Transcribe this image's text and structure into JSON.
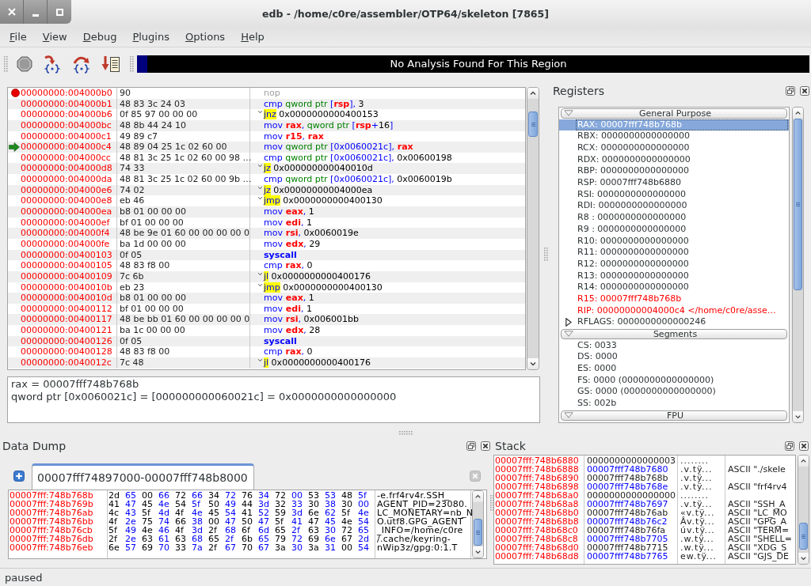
{
  "window": {
    "title": "edb - /home/c0re/assembler/OTP64/skeleton [7865]"
  },
  "menu": [
    "File",
    "View",
    "Debug",
    "Plugins",
    "Options",
    "Help"
  ],
  "toolbar": {
    "analysis": "No Analysis Found For This Region"
  },
  "disassembly": {
    "rows": [
      {
        "address": "00000000:004000b0",
        "bytes": "90",
        "breakpoint": true,
        "current": false,
        "kind": "nop",
        "mnemonic": "nop"
      },
      {
        "address": "00000000:004000b1",
        "bytes": "48 83 3c 24 03",
        "breakpoint": false,
        "current": false,
        "kind": "normal",
        "mnemonic": "cmp",
        "operands": [
          {
            "kind": "size",
            "text": " qword ptr"
          },
          {
            "kind": "punct",
            "text": " ["
          },
          {
            "kind": "register",
            "text": "rsp"
          },
          {
            "kind": "punct",
            "text": "],"
          },
          {
            "kind": "number",
            "text": " 3"
          }
        ]
      },
      {
        "address": "00000000:004000b6",
        "bytes": "0f 85 97 00 00 00",
        "breakpoint": false,
        "current": false,
        "kind": "jump",
        "mnemonic": "jnz",
        "operands": [
          {
            "kind": "number",
            "text": " 0x0000000000400153"
          }
        ]
      },
      {
        "address": "00000000:004000bc",
        "bytes": "48 8b 44 24 10",
        "breakpoint": false,
        "current": false,
        "kind": "normal",
        "mnemonic": "mov",
        "operands": [
          {
            "kind": "register",
            "text": " rax"
          },
          {
            "kind": "punct",
            "text": ","
          },
          {
            "kind": "size",
            "text": " qword ptr"
          },
          {
            "kind": "punct",
            "text": " ["
          },
          {
            "kind": "register",
            "text": "rsp"
          },
          {
            "kind": "punct",
            "text": "+"
          },
          {
            "kind": "number",
            "text": "16"
          },
          {
            "kind": "punct",
            "text": "]"
          }
        ]
      },
      {
        "address": "00000000:004000c1",
        "bytes": "49 89 c7",
        "breakpoint": false,
        "current": false,
        "kind": "normal",
        "mnemonic": "mov",
        "operands": [
          {
            "kind": "register",
            "text": " r15"
          },
          {
            "kind": "punct",
            "text": ","
          },
          {
            "kind": "register",
            "text": " rax"
          }
        ]
      },
      {
        "address": "00000000:004000c4",
        "bytes": "48 89 04 25 1c 02 60 00",
        "breakpoint": false,
        "current": true,
        "kind": "normal",
        "mnemonic": "mov",
        "operands": [
          {
            "kind": "size",
            "text": " qword ptr"
          },
          {
            "kind": "punct",
            "text": " [0x0060021c],"
          },
          {
            "kind": "register",
            "text": " rax"
          }
        ]
      },
      {
        "address": "00000000:004000cc",
        "bytes": "48 81 3c 25 1c 02 60 00 98 …",
        "breakpoint": false,
        "current": false,
        "kind": "normal",
        "mnemonic": "cmp",
        "operands": [
          {
            "kind": "size",
            "text": " qword ptr"
          },
          {
            "kind": "punct",
            "text": " [0x0060021c],"
          },
          {
            "kind": "number",
            "text": " 0x00600198"
          }
        ]
      },
      {
        "address": "00000000:004000d8",
        "bytes": "74 33",
        "breakpoint": false,
        "current": false,
        "kind": "jump",
        "mnemonic": "jz",
        "operands": [
          {
            "kind": "number",
            "text": " 0x000000000040010d"
          }
        ]
      },
      {
        "address": "00000000:004000da",
        "bytes": "48 81 3c 25 1c 02 60 00 9b …",
        "breakpoint": false,
        "current": false,
        "kind": "normal",
        "mnemonic": "cmp",
        "operands": [
          {
            "kind": "size",
            "text": " qword ptr"
          },
          {
            "kind": "punct",
            "text": " [0x0060021c],"
          },
          {
            "kind": "number",
            "text": " 0x0060019b"
          }
        ]
      },
      {
        "address": "00000000:004000e6",
        "bytes": "74 02",
        "breakpoint": false,
        "current": false,
        "kind": "jump",
        "mnemonic": "jz",
        "operands": [
          {
            "kind": "number",
            "text": " 0x00000000004000ea"
          }
        ]
      },
      {
        "address": "00000000:004000e8",
        "bytes": "eb 46",
        "breakpoint": false,
        "current": false,
        "kind": "jump",
        "mnemonic": "jmp",
        "operands": [
          {
            "kind": "number",
            "text": " 0x0000000000400130"
          }
        ]
      },
      {
        "address": "00000000:004000ea",
        "bytes": "b8 01 00 00 00",
        "breakpoint": false,
        "current": false,
        "kind": "normal",
        "mnemonic": "mov",
        "operands": [
          {
            "kind": "register",
            "text": " eax"
          },
          {
            "kind": "punct",
            "text": ","
          },
          {
            "kind": "number",
            "text": " 1"
          }
        ]
      },
      {
        "address": "00000000:004000ef",
        "bytes": "bf 01 00 00 00",
        "breakpoint": false,
        "current": false,
        "kind": "normal",
        "mnemonic": "mov",
        "operands": [
          {
            "kind": "register",
            "text": " edi"
          },
          {
            "kind": "punct",
            "text": ","
          },
          {
            "kind": "number",
            "text": " 1"
          }
        ]
      },
      {
        "address": "00000000:004000f4",
        "bytes": "48 be 9e 01 60 00 00 00 00 0",
        "breakpoint": false,
        "current": false,
        "kind": "normal",
        "mnemonic": "mov",
        "operands": [
          {
            "kind": "register",
            "text": " rsi"
          },
          {
            "kind": "punct",
            "text": ","
          },
          {
            "kind": "number",
            "text": " 0x0060019e"
          }
        ]
      },
      {
        "address": "00000000:004000fe",
        "bytes": "ba 1d 00 00 00",
        "breakpoint": false,
        "current": false,
        "kind": "normal",
        "mnemonic": "mov",
        "operands": [
          {
            "kind": "register",
            "text": " edx"
          },
          {
            "kind": "punct",
            "text": ","
          },
          {
            "kind": "number",
            "text": " 29"
          }
        ]
      },
      {
        "address": "00000000:00400103",
        "bytes": "0f 05",
        "breakpoint": false,
        "current": false,
        "kind": "syscall",
        "mnemonic": "syscall"
      },
      {
        "address": "00000000:00400105",
        "bytes": "48 83 f8 00",
        "breakpoint": false,
        "current": false,
        "kind": "normal",
        "mnemonic": "cmp",
        "operands": [
          {
            "kind": "register",
            "text": " rax"
          },
          {
            "kind": "punct",
            "text": ","
          },
          {
            "kind": "number",
            "text": " 0"
          }
        ]
      },
      {
        "address": "00000000:00400109",
        "bytes": "7c 6b",
        "breakpoint": false,
        "current": false,
        "kind": "jump",
        "mnemonic": "jl",
        "operands": [
          {
            "kind": "number",
            "text": " 0x0000000000400176"
          }
        ]
      },
      {
        "address": "00000000:0040010b",
        "bytes": "eb 23",
        "breakpoint": false,
        "current": false,
        "kind": "jump",
        "mnemonic": "jmp",
        "operands": [
          {
            "kind": "number",
            "text": " 0x0000000000400130"
          }
        ]
      },
      {
        "address": "00000000:0040010d",
        "bytes": "b8 01 00 00 00",
        "breakpoint": false,
        "current": false,
        "kind": "normal",
        "mnemonic": "mov",
        "operands": [
          {
            "kind": "register",
            "text": " eax"
          },
          {
            "kind": "punct",
            "text": ","
          },
          {
            "kind": "number",
            "text": " 1"
          }
        ]
      },
      {
        "address": "00000000:00400112",
        "bytes": "bf 01 00 00 00",
        "breakpoint": false,
        "current": false,
        "kind": "normal",
        "mnemonic": "mov",
        "operands": [
          {
            "kind": "register",
            "text": " edi"
          },
          {
            "kind": "punct",
            "text": ","
          },
          {
            "kind": "number",
            "text": " 1"
          }
        ]
      },
      {
        "address": "00000000:00400117",
        "bytes": "48 be bb 01 60 00 00 00 00 0",
        "breakpoint": false,
        "current": false,
        "kind": "normal",
        "mnemonic": "mov",
        "operands": [
          {
            "kind": "register",
            "text": " rsi"
          },
          {
            "kind": "punct",
            "text": ","
          },
          {
            "kind": "number",
            "text": " 0x006001bb"
          }
        ]
      },
      {
        "address": "00000000:00400121",
        "bytes": "ba 1c 00 00 00",
        "breakpoint": false,
        "current": false,
        "kind": "normal",
        "mnemonic": "mov",
        "operands": [
          {
            "kind": "register",
            "text": " edx"
          },
          {
            "kind": "punct",
            "text": ","
          },
          {
            "kind": "number",
            "text": " 28"
          }
        ]
      },
      {
        "address": "00000000:00400126",
        "bytes": "0f 05",
        "breakpoint": false,
        "current": false,
        "kind": "syscall",
        "mnemonic": "syscall"
      },
      {
        "address": "00000000:00400128",
        "bytes": "48 83 f8 00",
        "breakpoint": false,
        "current": false,
        "kind": "normal",
        "mnemonic": "cmp",
        "operands": [
          {
            "kind": "register",
            "text": " rax"
          },
          {
            "kind": "punct",
            "text": ","
          },
          {
            "kind": "number",
            "text": " 0"
          }
        ]
      },
      {
        "address": "00000000:0040012c",
        "bytes": "7c 48",
        "breakpoint": false,
        "current": false,
        "kind": "jump",
        "mnemonic": "jl",
        "operands": [
          {
            "kind": "number",
            "text": " 0x0000000000400176"
          }
        ]
      }
    ]
  },
  "expression": [
    "rax = 00007fff748b768b",
    "qword ptr [0x0060021c] = [000000000060021c] = 0x0000000000000000"
  ],
  "registers": {
    "title": "Registers",
    "groups": [
      {
        "title": "General Purpose",
        "expanded": true,
        "registers": [
          {
            "text": "RAX: 00007fff748b768b",
            "selected": true,
            "changed": false
          },
          {
            "text": "RBX: 0000000000000000",
            "selected": false,
            "changed": false
          },
          {
            "text": "RCX: 0000000000000000",
            "selected": false,
            "changed": false
          },
          {
            "text": "RDX: 0000000000000000",
            "selected": false,
            "changed": false
          },
          {
            "text": "RBP: 0000000000000000",
            "selected": false,
            "changed": false
          },
          {
            "text": "RSP: 00007fff748b6880",
            "selected": false,
            "changed": false
          },
          {
            "text": "RSI: 0000000000000000",
            "selected": false,
            "changed": false
          },
          {
            "text": "RDI: 0000000000000000",
            "selected": false,
            "changed": false
          },
          {
            "text": "R8 : 0000000000000000",
            "selected": false,
            "changed": false
          },
          {
            "text": "R9 : 0000000000000000",
            "selected": false,
            "changed": false
          },
          {
            "text": "R10: 0000000000000000",
            "selected": false,
            "changed": false
          },
          {
            "text": "R11: 0000000000000000",
            "selected": false,
            "changed": false
          },
          {
            "text": "R12: 0000000000000000",
            "selected": false,
            "changed": false
          },
          {
            "text": "R13: 0000000000000000",
            "selected": false,
            "changed": false
          },
          {
            "text": "R14: 0000000000000000",
            "selected": false,
            "changed": false
          },
          {
            "text": "R15: 00007fff748b768b",
            "selected": false,
            "changed": true
          },
          {
            "text": "RIP: 00000000004000c4 </home/c0re/asse…",
            "selected": false,
            "changed": true
          }
        ],
        "flags": {
          "text": "RFLAGS: 0000000000000246",
          "expanded": false
        }
      },
      {
        "title": "Segments",
        "expanded": true,
        "registers": [
          {
            "text": "CS: 0033",
            "selected": false,
            "changed": false
          },
          {
            "text": "DS: 0000",
            "selected": false,
            "changed": false
          },
          {
            "text": "ES: 0000",
            "selected": false,
            "changed": false
          },
          {
            "text": "FS: 0000 (0000000000000000)",
            "selected": false,
            "changed": false
          },
          {
            "text": "GS: 0000 (0000000000000000)",
            "selected": false,
            "changed": false
          },
          {
            "text": "SS: 002b",
            "selected": false,
            "changed": false
          }
        ]
      },
      {
        "title": "FPU",
        "expanded": true
      }
    ]
  },
  "data_dump": {
    "title": "Data Dump",
    "tabs": [
      {
        "label": "00007fff74897000-00007fff748b8000",
        "selected": true
      }
    ],
    "rows": [
      {
        "address": "00007fff:748b768b",
        "bytes": "2d 65 00 66 72 66 34 72 76 34 72 00 53 53 48 5f",
        "ascii": "-e.frf4rv4r.SSH_"
      },
      {
        "address": "00007fff:748b769b",
        "bytes": "41 47 45 4e 54 5f 50 49 44 3d 32 33 30 38 30 00",
        "ascii": "AGENT_PID=23080."
      },
      {
        "address": "00007fff:748b76ab",
        "bytes": "4c 43 5f 4d 4f 4e 45 54 41 52 59 3d 6e 62 5f 4e",
        "ascii": "LC_MONETARY=nb_N"
      },
      {
        "address": "00007fff:748b76bb",
        "bytes": "4f 2e 75 74 66 38 00 47 50 47 5f 41 47 45 4e 54",
        "ascii": "O.utf8.GPG_AGENT"
      },
      {
        "address": "00007fff:748b76cb",
        "bytes": "5f 49 4e 46 4f 3d 2f 68 6f 6d 65 2f 63 30 72 65",
        "ascii": "_INFO=/home/c0re"
      },
      {
        "address": "00007fff:748b76db",
        "bytes": "2f 2e 63 61 63 68 65 2f 6b 65 79 72 69 6e 67 2d",
        "ascii": "/.cache/keyring-"
      },
      {
        "address": "00007fff:748b76eb",
        "bytes": "6e 57 69 70 33 7a 2f 67 70 67 3a 30 3a 31 00 54",
        "ascii": "nWip3z/gpg:0:1.T"
      }
    ]
  },
  "stack": {
    "title": "Stack",
    "rows": [
      {
        "address": "00007fff:748b6880",
        "value": "0000000000000003",
        "ascii": "........"
      },
      {
        "address": "00007fff:748b6888",
        "value": "00007fff748b7680",
        "ascii": ".v.tÿ...",
        "comment": "ASCII \"./skele"
      },
      {
        "address": "00007fff:748b6890",
        "value": "00007fff748b768b",
        "ascii": ".v.tÿ..."
      },
      {
        "address": "00007fff:748b6898",
        "value": "00007fff748b768e",
        "ascii": ".v.tÿ...",
        "comment": "ASCII \"frf4rv4"
      },
      {
        "address": "00007fff:748b68a0",
        "value": "0000000000000000",
        "ascii": "........"
      },
      {
        "address": "00007fff:748b68a8",
        "value": "00007fff748b7697",
        "ascii": ".v.tÿ...",
        "comment": "ASCII \"SSH_A"
      },
      {
        "address": "00007fff:748b68b0",
        "value": "00007fff748b76ab",
        "ascii": "«v.tÿ...",
        "comment": "ASCII \"LC_MO"
      },
      {
        "address": "00007fff:748b68b8",
        "value": "00007fff748b76c2",
        "ascii": "Âv.tÿ...",
        "comment": "ASCII \"GPG_A"
      },
      {
        "address": "00007fff:748b68c0",
        "value": "00007fff748b76fa",
        "ascii": "úv.tÿ...",
        "comment": "ASCII \"TERM="
      },
      {
        "address": "00007fff:748b68c8",
        "value": "00007fff748b7705",
        "ascii": ".w.tÿ...",
        "comment": "ASCII \"SHELL="
      },
      {
        "address": "00007fff:748b68d0",
        "value": "00007fff748b7715",
        "ascii": ".w.tÿ...",
        "comment": "ASCII \"XDG_S"
      },
      {
        "address": "00007fff:748b68d8",
        "value": "00007fff748b7765",
        "ascii": "ew.tÿ...",
        "comment": "ASCII \"GJS_DE"
      }
    ]
  },
  "status_bar": {
    "text": "paused"
  }
}
